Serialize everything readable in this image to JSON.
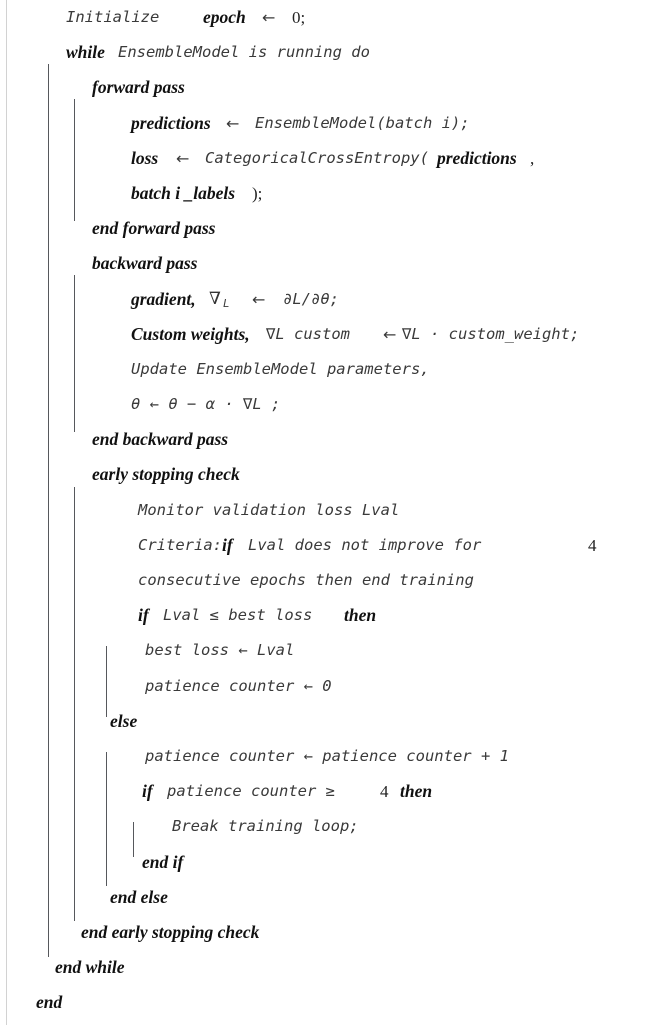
{
  "figure": {
    "kind": "algorithm-pseudocode",
    "rule_color": "#56585c",
    "page_edge_color": "#d2d2d2",
    "text_color": "#1a1a1a"
  },
  "lines": {
    "l01_initialize": "Initialize",
    "l01_epoch": "epoch",
    "l01_arrow": "←",
    "l01_zero": "0;",
    "l02_while": "while",
    "l02_cond": "EnsembleModel is running do",
    "l03_forward_pass": "forward pass",
    "l04_predictions": "predictions",
    "l04_arrow": "←",
    "l04_call": "EnsembleModel(batch i);",
    "l05_loss": "loss",
    "l05_arrow": "←",
    "l05_fn": "CategoricalCrossEntropy(",
    "l05_arg": "predictions",
    "l05_comma": ",",
    "l06_batch_labels": "batch  i  _labels",
    "l06_close": ");",
    "l07_end_forward": "end forward pass",
    "l08_backward_pass": "backward pass",
    "l09_gradient": "gradient,",
    "l09_nabla": "∇",
    "l09_sub": "L",
    "l09_arrow": "←",
    "l09_expr": "∂L/∂θ;",
    "l10_custom": "Custom weights,",
    "l10_lhs": "∇L custom",
    "l10_arrow": "←",
    "l10_rhs": "∇L · custom_weight;",
    "l11_update": "Update EnsembleModel parameters,",
    "l12_theta": "θ ← θ − α · ∇L ;",
    "l13_end_backward": "end backward pass",
    "l14_early_stopping": "early stopping check",
    "l15_monitor": "Monitor validation loss Lval",
    "l16_criteria": "Criteria:",
    "l16_if": "if",
    "l16_rest": "Lval does not improve for",
    "l16_four": "4",
    "l17_consecutive": "consecutive epochs then end training",
    "l18_if": "if",
    "l18_cond": "Lval ≤ best loss",
    "l18_then": "then",
    "l19_best_loss": "best loss ← Lval",
    "l20_patience_zero": "patience counter ← 0",
    "l21_else": "else",
    "l22_patience_inc": "patience counter ← patience counter + 1",
    "l23_if": "if",
    "l23_cond": "patience counter ≥",
    "l23_four": "4",
    "l23_then": "then",
    "l24_break": "Break training loop;",
    "l25_end_if": "end if",
    "l26_end_else": "end else",
    "l27_end_early": "end early stopping check",
    "l28_end_while": "end while",
    "l29_end": "end"
  }
}
